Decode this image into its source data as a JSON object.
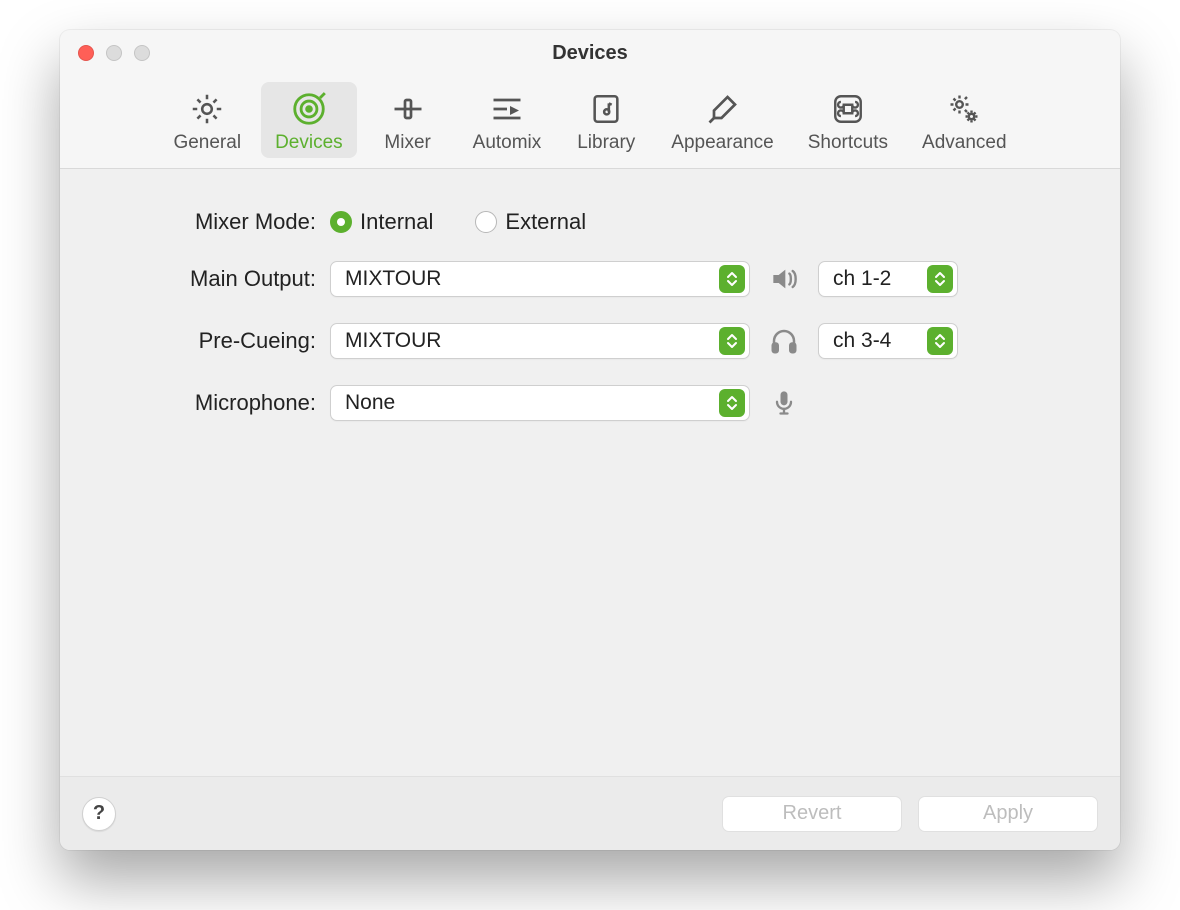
{
  "window": {
    "title": "Devices"
  },
  "tabs": [
    {
      "label": "General"
    },
    {
      "label": "Devices"
    },
    {
      "label": "Mixer"
    },
    {
      "label": "Automix"
    },
    {
      "label": "Library"
    },
    {
      "label": "Appearance"
    },
    {
      "label": "Shortcuts"
    },
    {
      "label": "Advanced"
    }
  ],
  "form": {
    "mixer_mode": {
      "label": "Mixer Mode:",
      "internal": "Internal",
      "external": "External"
    },
    "main_output": {
      "label": "Main Output:",
      "device": "MIXTOUR",
      "channels": "ch 1-2"
    },
    "pre_cueing": {
      "label": "Pre-Cueing:",
      "device": "MIXTOUR",
      "channels": "ch 3-4"
    },
    "microphone": {
      "label": "Microphone:",
      "device": "None"
    }
  },
  "footer": {
    "help": "?",
    "revert": "Revert",
    "apply": "Apply"
  }
}
